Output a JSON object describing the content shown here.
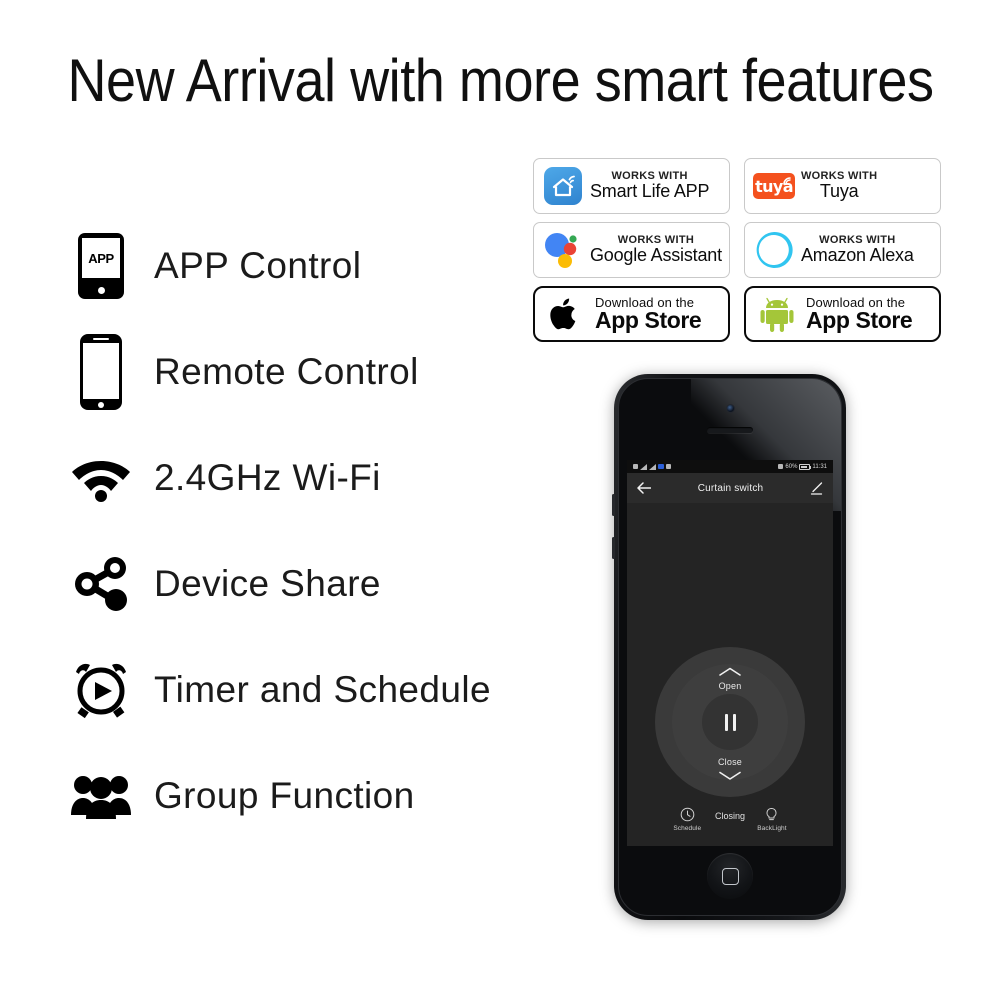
{
  "headline": "New Arrival with more smart features",
  "features": [
    {
      "icon": "app-phone-icon",
      "label": "APP Control",
      "icon_text": "APP"
    },
    {
      "icon": "smartphone-icon",
      "label": "Remote Control"
    },
    {
      "icon": "wifi-icon",
      "label": "2.4GHz Wi-Fi"
    },
    {
      "icon": "share-nodes-icon",
      "label": "Device Share"
    },
    {
      "icon": "alarm-clock-icon",
      "label": "Timer and Schedule"
    },
    {
      "icon": "group-people-icon",
      "label": "Group Function"
    }
  ],
  "badges": [
    {
      "icon": "smart-life-house-icon",
      "small": "WORKS WITH",
      "big": "Smart Life APP",
      "color": "#3E8FD6"
    },
    {
      "icon": "tuya-logo-icon",
      "small": "WORKS WITH",
      "big": "Tuya",
      "logo_text": "tuya",
      "color": "#F4511E"
    },
    {
      "icon": "google-assistant-icon",
      "small": "WORKS WITH",
      "big": "Google Assistant",
      "color": "#4285F4"
    },
    {
      "icon": "amazon-alexa-icon",
      "small": "WORKS WITH",
      "big": "Amazon Alexa",
      "color": "#31C5F0"
    }
  ],
  "stores": [
    {
      "icon": "apple-logo-icon",
      "small": "Download on the",
      "big": "App Store",
      "color": "#0A0A0A"
    },
    {
      "icon": "android-robot-icon",
      "small": "Download on the",
      "big": "App Store",
      "color": "#A4C639"
    }
  ],
  "phone": {
    "statusbar": {
      "battery_percent": "60%",
      "time": "11:31"
    },
    "appbar": {
      "back_icon": "back-arrow-icon",
      "title": "Curtain switch",
      "edit_icon": "edit-pencil-icon"
    },
    "control": {
      "open_label": "Open",
      "close_label": "Close",
      "center_icon": "pause-icon",
      "status": "Closing"
    },
    "tabs": [
      {
        "icon": "clock-icon",
        "label": "Schedule"
      },
      {
        "icon": "lightbulb-icon",
        "label": "BackLight"
      }
    ]
  }
}
